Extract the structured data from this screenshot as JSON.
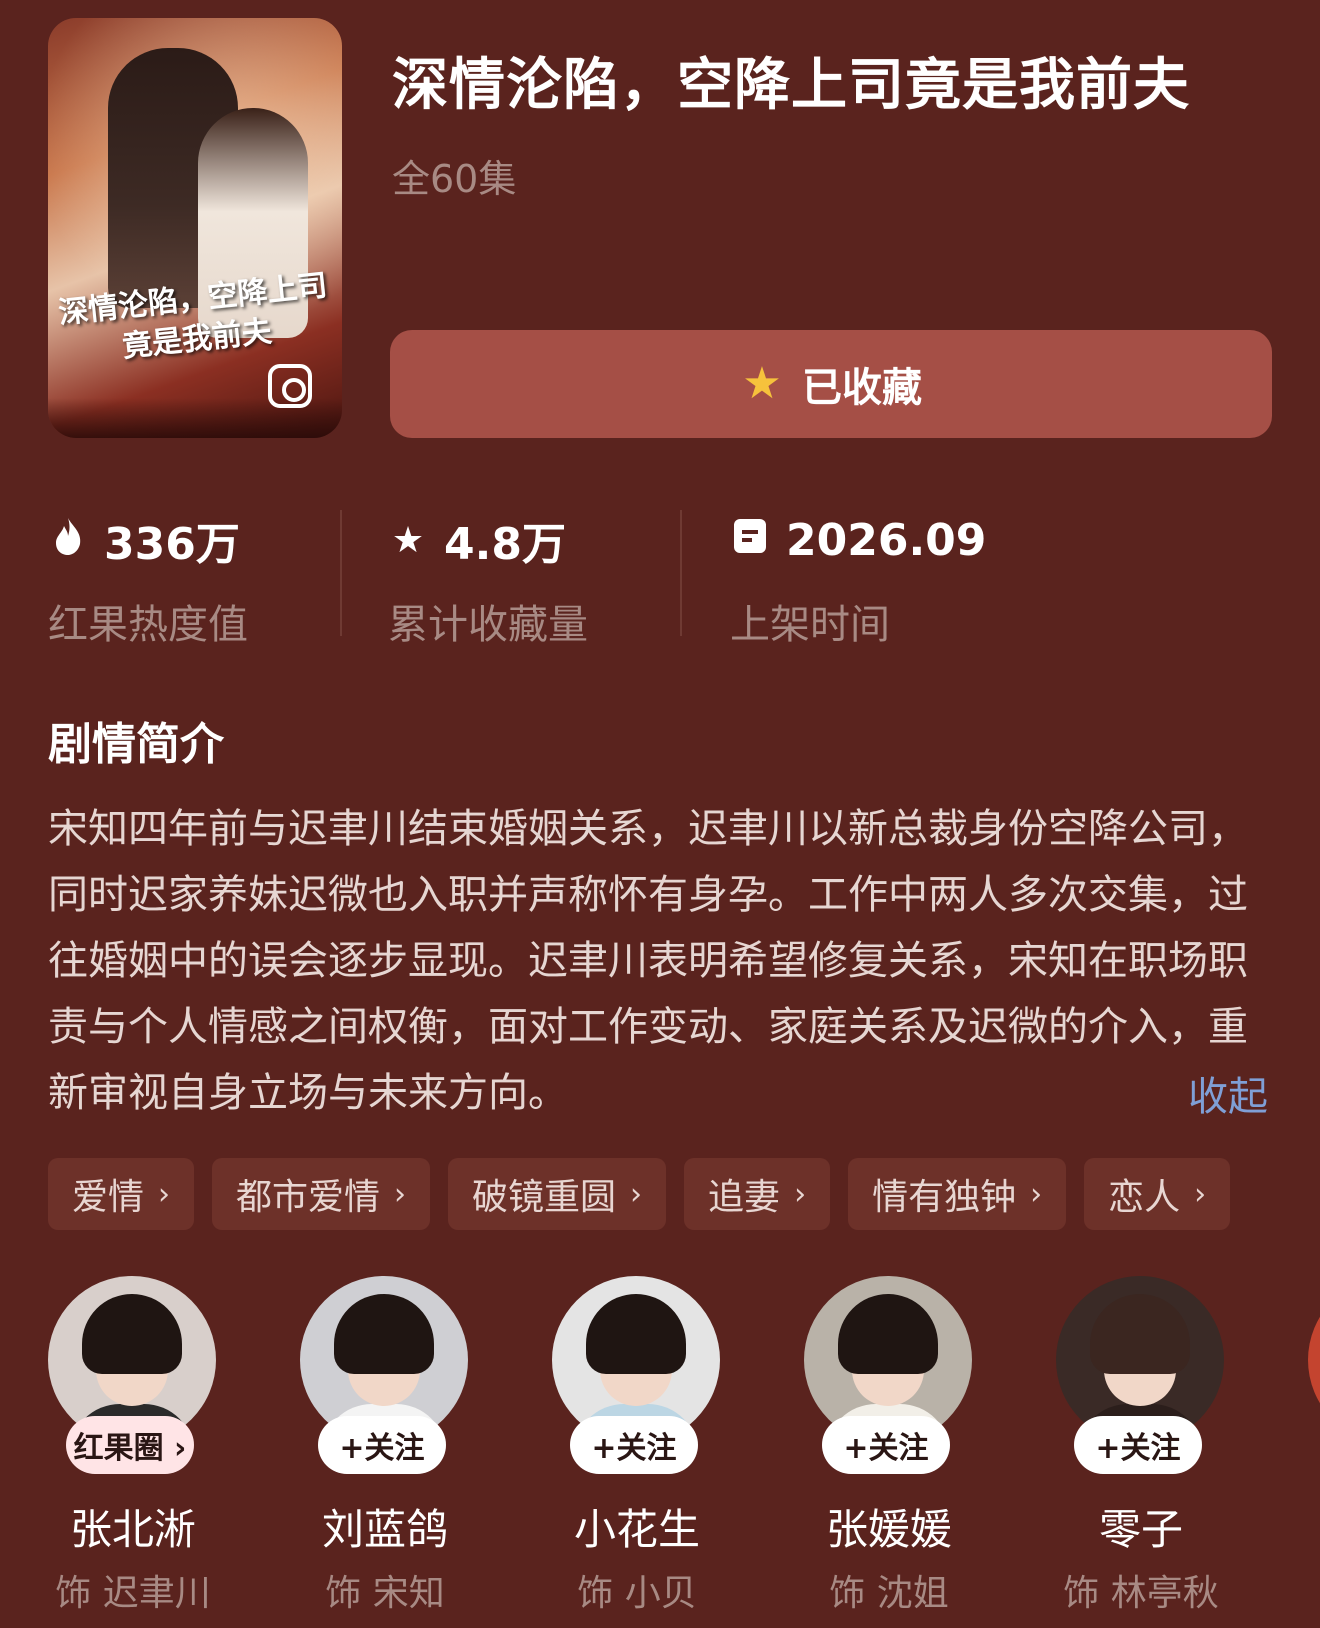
{
  "drama": {
    "title": "深情沦陷，空降上司竟是我前夫",
    "episodes": "全60集",
    "poster_title": "深情沦陷，空降上司竟是我前夫"
  },
  "favorite_button": {
    "label": "已收藏",
    "icon": "star-icon",
    "icon_color": "#f6c23c",
    "state": "favorited"
  },
  "stats": [
    {
      "icon": "flame-icon",
      "value": "336万",
      "label": "红果热度值"
    },
    {
      "icon": "star-icon",
      "value": "4.8万",
      "label": "累计收藏量"
    },
    {
      "icon": "calendar-icon",
      "value": "2026.09",
      "label": "上架时间"
    }
  ],
  "synopsis": {
    "heading": "剧情简介",
    "text": "宋知四年前与迟聿川结束婚姻关系，迟聿川以新总裁身份空降公司，同时迟家养妹迟微也入职并声称怀有身孕。工作中两人多次交集，过往婚姻中的误会逐步显现。迟聿川表明希望修复关系，宋知在职场职责与个人情感之间权衡，面对工作变动、家庭关系及迟微的介入，重新审视自身立场与未来方向。",
    "collapse_label": "收起"
  },
  "tags": [
    "爱情",
    "都市爱情",
    "破镜重圆",
    "追妻",
    "情有独钟",
    "恋人"
  ],
  "cast": [
    {
      "name": "张北淅",
      "role": "饰 迟聿川",
      "action": "红果圈 ›"
    },
    {
      "name": "刘蓝鸽",
      "role": "饰 宋知",
      "action": "+关注"
    },
    {
      "name": "小花生",
      "role": "饰 小贝",
      "action": "+关注"
    },
    {
      "name": "张媛媛",
      "role": "饰 沈姐",
      "action": "+关注"
    },
    {
      "name": "零子",
      "role": "饰 林亭秋",
      "action": "+关注"
    }
  ],
  "colors": {
    "background": "#5a231e",
    "button": "#a54f46",
    "tag": "#6d3129",
    "link": "#7f9fd6",
    "muted": "#a88a84"
  }
}
